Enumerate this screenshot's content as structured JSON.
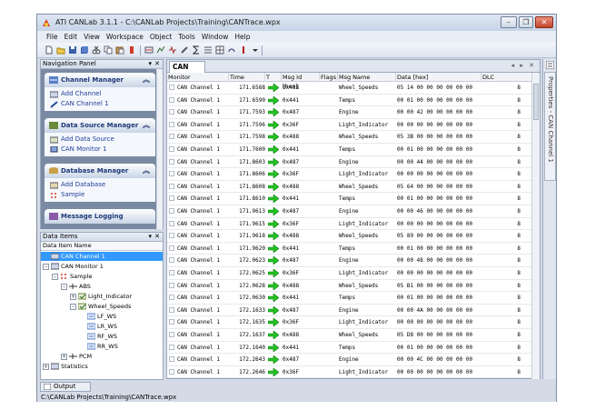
{
  "window": {
    "title": "ATI CANLab 3.1.1 - C:\\CANLab Projects\\Training\\CANTrace.wpx",
    "minimize": "–",
    "restore": "❐",
    "close": "✕"
  },
  "menu": [
    "File",
    "Edit",
    "View",
    "Workspace",
    "Object",
    "Tools",
    "Window",
    "Help"
  ],
  "nav_panel": {
    "title": "Navigation Panel",
    "pin": "▾ ✕",
    "sections": [
      {
        "title": "Channel Manager",
        "items": [
          "Add Channel",
          "CAN Channel 1"
        ]
      },
      {
        "title": "Data Source Manager",
        "items": [
          "Add Data Source",
          "CAN Monitor 1"
        ]
      },
      {
        "title": "Database Manager",
        "items": [
          "Add Database",
          "Sample"
        ]
      },
      {
        "title": "Message Logging",
        "items": []
      }
    ]
  },
  "data_items": {
    "title": "Data Items",
    "column": "Data Item Name",
    "tree": [
      {
        "label": "CAN Channel 1",
        "level": 0,
        "exp": "",
        "selected": true
      },
      {
        "label": "CAN Monitor 1",
        "level": 0,
        "exp": "–"
      },
      {
        "label": "Sample",
        "level": 1,
        "exp": "–"
      },
      {
        "label": "ABS",
        "level": 2,
        "exp": "–"
      },
      {
        "label": "Light_Indicator",
        "level": 3,
        "exp": "+"
      },
      {
        "label": "Wheel_Speeds",
        "level": 3,
        "exp": "–"
      },
      {
        "label": "LF_WS",
        "level": 4,
        "exp": ""
      },
      {
        "label": "LR_WS",
        "level": 4,
        "exp": ""
      },
      {
        "label": "RF_WS",
        "level": 4,
        "exp": ""
      },
      {
        "label": "RR_WS",
        "level": 4,
        "exp": ""
      },
      {
        "label": "PCM",
        "level": 2,
        "exp": "+"
      },
      {
        "label": "Statistics",
        "level": 0,
        "exp": "+"
      }
    ]
  },
  "trace": {
    "tab": "CAN Trace",
    "tab_nav": "◂ ▸ ✕",
    "columns": [
      "Monitor",
      "Time",
      "T",
      "Msg Id [hex]",
      "Flags",
      "Msg Name",
      "Data [hex]",
      "DLC"
    ],
    "rows": [
      [
        "CAN Channel 1",
        "171.6588",
        "0x488",
        "Wheel_Speeds",
        "05 14 00 00 00 00 00 00",
        "8"
      ],
      [
        "CAN Channel 1",
        "171.6590",
        "0x441",
        "Temps",
        "00 01 00 00 00 00 00 00",
        "8"
      ],
      [
        "CAN Channel 1",
        "171.7593",
        "0x487",
        "Engine",
        "00 00 42 00 00 00 00 00",
        "8"
      ],
      [
        "CAN Channel 1",
        "171.7596",
        "0x36F",
        "Light_Indicator",
        "00 00 00 00 00 00 00 00",
        "8"
      ],
      [
        "CAN Channel 1",
        "171.7598",
        "0x488",
        "Wheel_Speeds",
        "05 3B 00 00 00 00 00 00",
        "8"
      ],
      [
        "CAN Channel 1",
        "171.7600",
        "0x441",
        "Temps",
        "00 01 00 00 00 00 00 00",
        "8"
      ],
      [
        "CAN Channel 1",
        "171.8603",
        "0x487",
        "Engine",
        "00 00 44 00 00 00 00 00",
        "8"
      ],
      [
        "CAN Channel 1",
        "171.8606",
        "0x36F",
        "Light_Indicator",
        "00 00 00 00 00 00 00 00",
        "8"
      ],
      [
        "CAN Channel 1",
        "171.8608",
        "0x488",
        "Wheel_Speeds",
        "05 64 00 00 00 00 00 00",
        "8"
      ],
      [
        "CAN Channel 1",
        "171.8610",
        "0x441",
        "Temps",
        "00 01 00 00 00 00 00 00",
        "8"
      ],
      [
        "CAN Channel 1",
        "171.9613",
        "0x487",
        "Engine",
        "00 00 46 00 00 00 00 00",
        "8"
      ],
      [
        "CAN Channel 1",
        "171.9615",
        "0x36F",
        "Light_Indicator",
        "00 00 00 00 00 00 00 00",
        "8"
      ],
      [
        "CAN Channel 1",
        "171.9618",
        "0x488",
        "Wheel_Speeds",
        "05 89 00 00 00 00 00 00",
        "8"
      ],
      [
        "CAN Channel 1",
        "171.9620",
        "0x441",
        "Temps",
        "00 01 00 00 00 00 00 00",
        "8"
      ],
      [
        "CAN Channel 1",
        "172.0623",
        "0x487",
        "Engine",
        "00 00 48 00 00 00 00 00",
        "8"
      ],
      [
        "CAN Channel 1",
        "172.0625",
        "0x36F",
        "Light_Indicator",
        "00 00 00 00 00 00 00 00",
        "8"
      ],
      [
        "CAN Channel 1",
        "172.0628",
        "0x488",
        "Wheel_Speeds",
        "05 B1 00 00 00 00 00 00",
        "8"
      ],
      [
        "CAN Channel 1",
        "172.0630",
        "0x441",
        "Temps",
        "00 01 00 00 00 00 00 00",
        "8"
      ],
      [
        "CAN Channel 1",
        "172.1633",
        "0x487",
        "Engine",
        "00 00 4A 00 00 00 00 00",
        "8"
      ],
      [
        "CAN Channel 1",
        "172.1635",
        "0x36F",
        "Light_Indicator",
        "00 00 00 00 00 00 00 00",
        "8"
      ],
      [
        "CAN Channel 1",
        "172.1637",
        "0x488",
        "Wheel_Speeds",
        "05 D8 00 00 00 00 00 00",
        "8"
      ],
      [
        "CAN Channel 1",
        "172.1640",
        "0x441",
        "Temps",
        "00 01 00 00 00 00 00 00",
        "8"
      ],
      [
        "CAN Channel 1",
        "172.2643",
        "0x487",
        "Engine",
        "00 00 4C 00 00 00 00 00",
        "8"
      ],
      [
        "CAN Channel 1",
        "172.2646",
        "0x36F",
        "Light_Indicator",
        "00 00 00 00 00 00 00 00",
        "8"
      ]
    ]
  },
  "properties_tab": "Properties - CAN Channel 1",
  "output_tab": "Output",
  "status": "C:\\CANLab Projects\\Training\\CANTrace.wpx",
  "colors": {
    "accent": "#3399ff",
    "nav_bg": "#7a8aa3",
    "arrow": "#22c322",
    "link": "#1f3f9a"
  }
}
